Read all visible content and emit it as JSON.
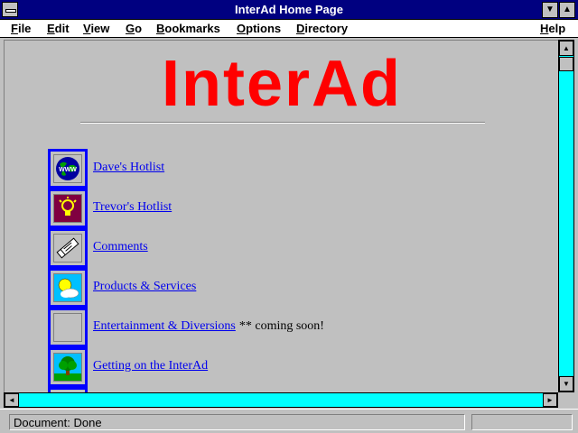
{
  "window": {
    "title": "InterAd Home Page",
    "min_glyph": "▼",
    "max_glyph": "▲"
  },
  "menu": {
    "items": [
      {
        "ul": "F",
        "rest": "ile"
      },
      {
        "ul": "E",
        "rest": "dit"
      },
      {
        "ul": "V",
        "rest": "iew"
      },
      {
        "ul": "G",
        "rest": "o"
      },
      {
        "ul": "B",
        "rest": "ookmarks"
      },
      {
        "ul": "O",
        "rest": "ptions"
      },
      {
        "ul": "D",
        "rest": "irectory"
      },
      {
        "ul": "H",
        "rest": "elp"
      }
    ]
  },
  "page": {
    "logo_text": "InterAd",
    "links": [
      {
        "label": "Dave's Hotlist",
        "icon": "globe-icon",
        "note": ""
      },
      {
        "label": "Trevor's Hotlist",
        "icon": "lightbulb-icon",
        "note": ""
      },
      {
        "label": "Comments",
        "icon": "pen-icon",
        "note": ""
      },
      {
        "label": "Products & Services",
        "icon": "sun-cloud-icon",
        "note": ""
      },
      {
        "label": "Entertainment & Diversions",
        "icon": "blank-icon",
        "note": "** coming soon!"
      },
      {
        "label": "Getting on the InterAd",
        "icon": "tree-icon",
        "note": ""
      }
    ]
  },
  "scroll": {
    "up": "▲",
    "down": "▼",
    "left": "◄",
    "right": "►"
  },
  "status": {
    "text": "Document: Done"
  },
  "colors": {
    "title_bar": "#000080",
    "logo": "#ff0000",
    "link": "#0000ee",
    "scroll_track": "#00ffff"
  }
}
